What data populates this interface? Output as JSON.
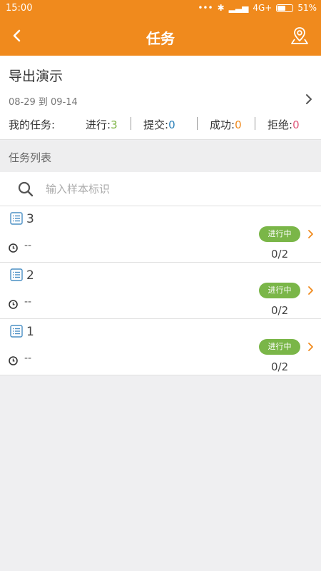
{
  "status_bar": {
    "time": "15:00",
    "network": "4G+",
    "battery": "51%"
  },
  "header": {
    "title": "任务"
  },
  "summary": {
    "name": "导出演示",
    "date_range": "08-29 到 09-14",
    "my_tasks_label": "我的任务:",
    "stats": [
      {
        "label": "进行:",
        "value": "3"
      },
      {
        "label": "提交:",
        "value": "0"
      },
      {
        "label": "成功:",
        "value": "0"
      },
      {
        "label": "拒绝:",
        "value": "0"
      }
    ]
  },
  "task_list": {
    "section_title": "任务列表",
    "search_placeholder": "输入样本标识",
    "items": [
      {
        "id": "3",
        "time": "--",
        "status": "进行中",
        "progress": "0/2"
      },
      {
        "id": "2",
        "time": "--",
        "status": "进行中",
        "progress": "0/2"
      },
      {
        "id": "1",
        "time": "--",
        "status": "进行中",
        "progress": "0/2"
      }
    ]
  },
  "colors": {
    "accent": "#f08a1d",
    "status_badge": "#7ab648",
    "running": "#7cb342",
    "submitted": "#2a7fb8",
    "success": "#f08a1d",
    "rejected": "#e0587a"
  }
}
